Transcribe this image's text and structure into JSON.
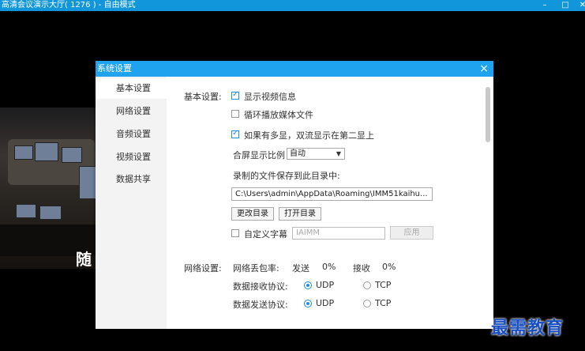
{
  "window": {
    "title": "高清会议演示大厅( 1276 ) - 自由模式",
    "minimize_icon": "minimize-icon",
    "maximize_icon": "maximize-icon",
    "close_icon": "close-icon",
    "accent": "#1296db"
  },
  "scene": {
    "caption": "随"
  },
  "dialog": {
    "title": "系统设置",
    "close_glyph": "×",
    "accent": "#1fa3ee"
  },
  "sidebar": {
    "items": [
      {
        "label": "基本设置",
        "active": true
      },
      {
        "label": "网络设置",
        "active": false
      },
      {
        "label": "音频设置",
        "active": false
      },
      {
        "label": "视频设置",
        "active": false
      },
      {
        "label": "数据共享",
        "active": false
      }
    ]
  },
  "basic": {
    "section_label": "基本设置:",
    "show_video_info": {
      "label": "显示视频信息",
      "checked": true
    },
    "loop_media": {
      "label": "循环播放媒体文件",
      "checked": false
    },
    "multi_screen": {
      "label": "如果有多显，双流显示在第二显上",
      "checked": true
    },
    "ratio_label": "合屏显示比例",
    "ratio_value": "自动",
    "record_dir_label": "录制的文件保存到此目录中:",
    "record_dir_value": "C:\\Users\\admin\\AppData\\Roaming\\IMM51kaihu...",
    "change_dir_button": "更改目录",
    "open_dir_button": "打开目录",
    "custom_caption": {
      "label": "自定义字幕",
      "checked": false
    },
    "caption_placeholder": "IAIMM",
    "apply_button": "应用"
  },
  "network": {
    "section_label": "网络设置:",
    "loss_label": "网络丢包率:",
    "send_label": "发送",
    "send_value": "0%",
    "recv_label": "接收",
    "recv_value": "0%",
    "recv_protocol_label": "数据接收协议:",
    "send_protocol_label": "数据发送协议:",
    "udp": "UDP",
    "tcp": "TCP",
    "recv_protocol": "UDP",
    "send_protocol": "UDP"
  },
  "watermark": {
    "text": "最需教育",
    "color": "#1a4fc0"
  }
}
